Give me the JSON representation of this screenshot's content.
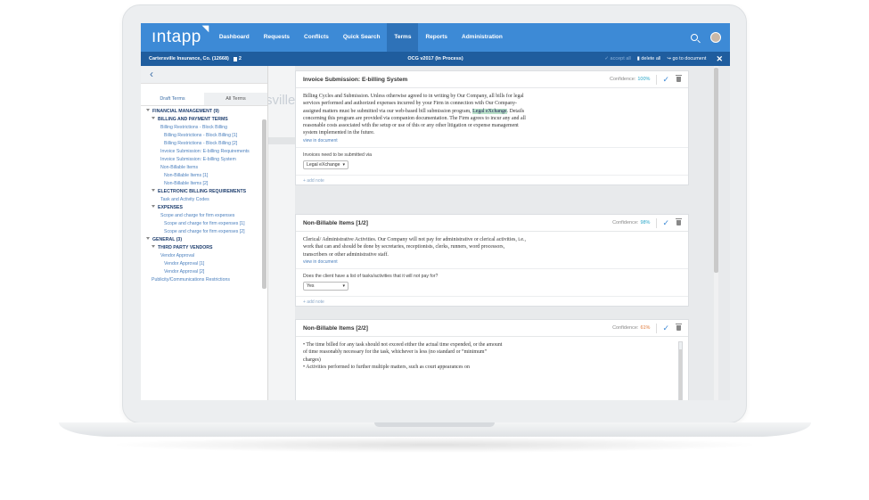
{
  "app": {
    "logo": "ıntapp",
    "nav": [
      "Dashboard",
      "Requests",
      "Conflicts",
      "Quick Search",
      "Terms",
      "Reports",
      "Administration"
    ],
    "active_nav": "Terms"
  },
  "subbar": {
    "client": "Cartersville Insurance, Co. (12668)",
    "doc_count": "2",
    "title": "OCG v2017 (In Process)",
    "accept_all": "accept all",
    "delete_all": "delete all",
    "go_to_document": "go to document",
    "close": "✕"
  },
  "left": {
    "back": "‹",
    "tabs": [
      "Draft Terms",
      "All Terms"
    ],
    "tree": [
      {
        "label": "FINANCIAL MANAGEMENT (9)",
        "level": 1,
        "head": true,
        "arrow": true
      },
      {
        "label": "BILLING AND PAYMENT TERMS",
        "level": 2,
        "head": true,
        "arrow": true
      },
      {
        "label": "Billing Restrictions - Block Billing",
        "level": 3
      },
      {
        "label": "Billing Restrictions - Block Billing [1]",
        "level": 4
      },
      {
        "label": "Billing Restrictions - Block Billing [2]",
        "level": 4
      },
      {
        "label": "Invoice Submission: E-billing Requirements",
        "level": 3
      },
      {
        "label": "Invoice Submission: E-billing System",
        "level": 3
      },
      {
        "label": "Non-Billable Items",
        "level": 3
      },
      {
        "label": "Non-Billable Items [1]",
        "level": 4
      },
      {
        "label": "Non-Billable Items [2]",
        "level": 4
      },
      {
        "label": "ELECTRONIC BILLING REQUIREMENTS",
        "level": 2,
        "head": true,
        "arrow": true
      },
      {
        "label": "Task and Activity Codes",
        "level": 3
      },
      {
        "label": "EXPENSES",
        "level": 2,
        "head": true,
        "arrow": true
      },
      {
        "label": "Scope and charge for firm expenses",
        "level": 3
      },
      {
        "label": "Scope and charge for firm expenses [1]",
        "level": 4
      },
      {
        "label": "Scope and charge for firm expenses [2]",
        "level": 4
      },
      {
        "label": "GENERAL (3)",
        "level": 1,
        "head": true,
        "arrow": true
      },
      {
        "label": "THIRD PARTY VENDORS",
        "level": 2,
        "head": true,
        "arrow": true
      },
      {
        "label": "Vendor Approval",
        "level": 3
      },
      {
        "label": "Vendor Approval [1]",
        "level": 4
      },
      {
        "label": "Vendor Approval [2]",
        "level": 4
      },
      {
        "label": "Publicity/Communications Restrictions",
        "level": 2
      }
    ]
  },
  "ghost_text": "sville",
  "cards": [
    {
      "title": "Invoice Submission: E-billing System",
      "confidence_label": "Confidence:",
      "confidence": "100%",
      "text_before": "Billing Cycles and Submission. Unless otherwise agreed to in writing by Our Company, all bills for legal services performed and authorized expenses incurred by your Firm in connection with Our Company-assigned matters must be submitted via our web-based bill submission program, ",
      "highlight": "Legal eXchange",
      "text_after": ". Details concerning this program are provided via companion documentation. The Firm agrees to incur any and all reasonable costs associated with the setup or use of this or any other litigation or expense management system implemented in the future.",
      "view": "view in document",
      "question": "Invoices need to be submitted via",
      "answer": "Legal eXchange",
      "add_note": "+ add note"
    },
    {
      "title": "Non-Billable Items [1/2]",
      "confidence_label": "Confidence:",
      "confidence": "98%",
      "text_before": "Clerical/ Administrative Activities. Our Company will not pay for administrative or clerical activities, i.e., work that can and should be done by secretaries, receptionists, clerks, runners, word processors, transcribers or other administrative staff.",
      "highlight": "",
      "text_after": "",
      "view": "view in document",
      "question": "Does the client have a list of tasks/activities that it will not pay for?",
      "answer": "Yes",
      "add_note": "+ add note"
    },
    {
      "title": "Non-Billable Items [2/2]",
      "confidence_label": "Confidence:",
      "confidence": "61%",
      "text_before": "• The time billed for any task should not exceed either the actual time expended, or the amount of time reasonably necessary for the task, whichever is less (no standard or “minimum” charges)\n• Activities performed to further multiple matters, such as court appearances on",
      "highlight": "",
      "text_after": "",
      "view": "",
      "question": "",
      "answer": "",
      "add_note": ""
    }
  ],
  "colors": {
    "nav": "#3d8ad6",
    "subbar": "#1f5d9e",
    "accent": "#2aa6c9",
    "confidence_low": "#e07a3a"
  }
}
